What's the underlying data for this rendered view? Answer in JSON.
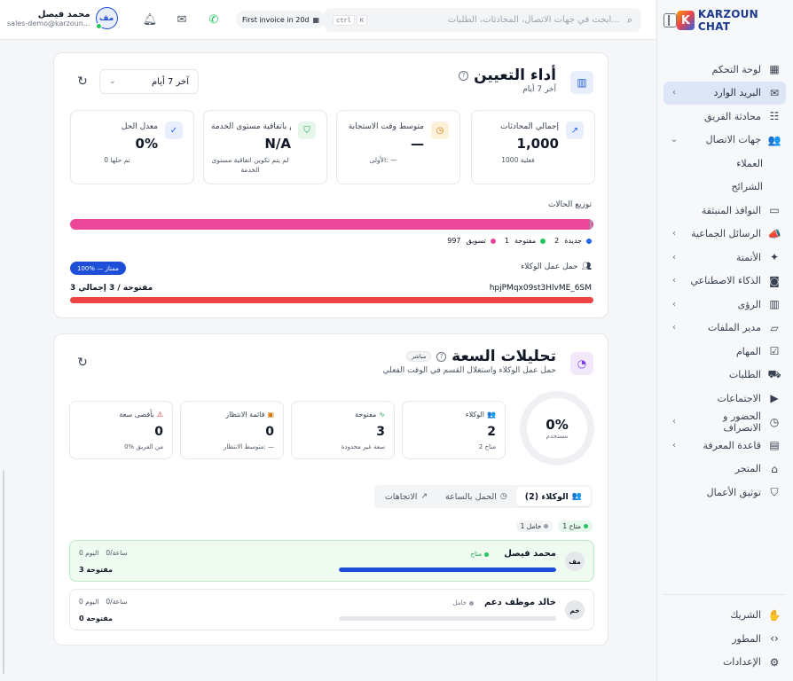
{
  "brand": {
    "name": "KARZOUN CHAT",
    "mark": "K"
  },
  "topbar": {
    "search_placeholder": "ابحث في جهات الاتصال، المحادثات، الطلبات...",
    "kbd_ctrl": "ctrl",
    "kbd_k": "K",
    "invoice_label": "First invoice in 20d",
    "user_name": "محمد فيصل",
    "user_email": "sales-demo@karzoun...",
    "user_initials": "مف"
  },
  "sidebar": {
    "items": [
      {
        "label": "لوحة التحكم",
        "icon": "dashboard-icon",
        "glyph": "▦",
        "chevron": ""
      },
      {
        "label": "البريد الوارد",
        "icon": "inbox-icon",
        "glyph": "✉",
        "chevron": "‹"
      },
      {
        "label": "محادثة الفريق",
        "icon": "team-chat-icon",
        "glyph": "☷",
        "chevron": ""
      },
      {
        "label": "جهات الاتصال",
        "icon": "contacts-icon",
        "glyph": "👥",
        "chevron": "⌄"
      },
      {
        "label": "العملاء",
        "icon": "",
        "glyph": "",
        "chevron": ""
      },
      {
        "label": "الشرائح",
        "icon": "",
        "glyph": "",
        "chevron": ""
      },
      {
        "label": "النوافذ المنبثقة",
        "icon": "popup-icon",
        "glyph": "▭",
        "chevron": ""
      },
      {
        "label": "الرسائل الجماعية",
        "icon": "megaphone-icon",
        "glyph": "📣",
        "chevron": "‹"
      },
      {
        "label": "الأتمتة",
        "icon": "automation-icon",
        "glyph": "✦",
        "chevron": "‹"
      },
      {
        "label": "الذكاء الاصطناعي",
        "icon": "bot-icon",
        "glyph": "◙",
        "chevron": "‹"
      },
      {
        "label": "الرؤى",
        "icon": "insights-icon",
        "glyph": "▥",
        "chevron": "‹"
      },
      {
        "label": "مدير الملفات",
        "icon": "folder-icon",
        "glyph": "▱",
        "chevron": "‹"
      },
      {
        "label": "المهام",
        "icon": "tasks-icon",
        "glyph": "☑",
        "chevron": ""
      },
      {
        "label": "الطلبات",
        "icon": "cart-icon",
        "glyph": "⛟",
        "chevron": ""
      },
      {
        "label": "الاجتماعات",
        "icon": "video-icon",
        "glyph": "▶",
        "chevron": ""
      },
      {
        "label": "الحضور و الانصراف",
        "icon": "clock-icon",
        "glyph": "◷",
        "chevron": "‹"
      },
      {
        "label": "قاعدة المعرفة",
        "icon": "book-icon",
        "glyph": "▤",
        "chevron": "‹"
      },
      {
        "label": "المتجر",
        "icon": "store-icon",
        "glyph": "⌂",
        "chevron": ""
      },
      {
        "label": "توثيق الأعمال",
        "icon": "shield-check-icon",
        "glyph": "⛉",
        "chevron": ""
      }
    ],
    "bottom": [
      {
        "label": "الشريك",
        "icon": "handshake-icon",
        "glyph": "✋"
      },
      {
        "label": "المطور",
        "icon": "code-icon",
        "glyph": "‹›"
      },
      {
        "label": "الإعدادات",
        "icon": "gear-icon",
        "glyph": "⚙"
      }
    ]
  },
  "assignment": {
    "title": "أداء التعيين",
    "subtitle": "آخر 7 أيام",
    "period": "آخر 7 أيام",
    "stats": [
      {
        "label": "إجمالي المحادثات",
        "value": "1,000",
        "note": "1000 فعلية",
        "icon": "trend-icon",
        "glyph": "↗",
        "color": "#2563eb",
        "bg": "#e8eefc"
      },
      {
        "label": "متوسط وقت الاستجابة",
        "value": "—",
        "note": "الأولى: —",
        "icon": "clock-icon",
        "glyph": "◷",
        "color": "#d97706",
        "bg": "#fdf1dc"
      },
      {
        "label": "الالتزام باتفاقية مستوى الخدمة",
        "value": "N/A",
        "note": "لم يتم تكوين اتفاقية مستوى الخدمة",
        "icon": "shield-icon",
        "glyph": "⛉",
        "color": "#16a34a",
        "bg": "#e6f6ea"
      },
      {
        "label": "معدل الحل",
        "value": "0%",
        "note": "0 تم حلها",
        "icon": "check-circle-icon",
        "glyph": "✓",
        "color": "#2563eb",
        "bg": "#e8eefc"
      }
    ],
    "distribution_title": "توزيع الحالات",
    "legend": [
      {
        "label": "جديدة",
        "count": "2",
        "color": "#2563eb"
      },
      {
        "label": "مفتوحة",
        "count": "1",
        "color": "#22c55e"
      },
      {
        "label": "تسويق",
        "count": "997",
        "color": "#ec4899"
      }
    ],
    "workload_title": "حمل عمل الوكلاء",
    "excellent_badge": "100% — ممتاز",
    "agent_id": "hpjPMqx09st3HlvME_6SM",
    "agent_count": "3 مفتوحة / 3 إجمالي"
  },
  "capacity": {
    "title": "تحليلات السعة",
    "live_badge": "مباشر",
    "subtitle": "حمل عمل الوكلاء واستغلال القسم في الوقت الفعلي",
    "gauge_value": "0%",
    "gauge_label": "مستخدم",
    "cards": [
      {
        "label": "الوكلاء",
        "value": "2",
        "note": "2 متاح",
        "glyph": "👥",
        "color": "#2563eb"
      },
      {
        "label": "مفتوحة",
        "value": "3",
        "note": "سعة غير محدودة",
        "glyph": "∿",
        "color": "#16a34a"
      },
      {
        "label": "قائمة الانتظار",
        "value": "0",
        "note": "متوسط الانتظار: —",
        "glyph": "▣",
        "color": "#d97706"
      },
      {
        "label": "بأقصى سعة",
        "value": "0",
        "note": "0% من الفريق",
        "glyph": "⚠",
        "color": "#dc2626"
      }
    ],
    "tabs": [
      {
        "label": "الوكلاء (2)",
        "icon": "users-icon",
        "glyph": "👥"
      },
      {
        "label": "الحمل بالساعة",
        "icon": "clock-icon",
        "glyph": "◷"
      },
      {
        "label": "الاتجاهات",
        "icon": "trend-icon",
        "glyph": "↗"
      }
    ],
    "chips": [
      {
        "label": "1 متاح",
        "color": "#22c55e",
        "bg": "#e7f8ec"
      },
      {
        "label": "1 خامل",
        "color": "#9ca3af",
        "bg": "#f3f4f6"
      }
    ],
    "agents": [
      {
        "initials": "مف",
        "name": "محمد فيصل",
        "status": "متاح",
        "status_color": "#22c55e",
        "per_hour": "0/ساعة",
        "today": "0 اليوم",
        "open": "3 مفتوحة",
        "load": 1.0
      },
      {
        "initials": "خم",
        "name": "خالد موظف دعم",
        "status": "خامل",
        "status_color": "#9ca3af",
        "per_hour": "0/ساعة",
        "today": "0 اليوم",
        "open": "0 مفتوحة",
        "load": 0
      }
    ]
  }
}
